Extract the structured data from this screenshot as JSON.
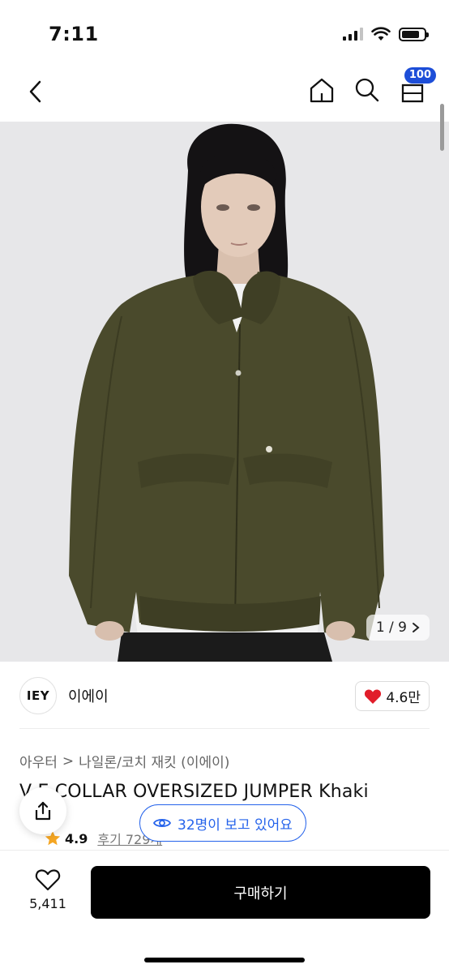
{
  "status_bar": {
    "time": "7:11"
  },
  "nav": {
    "cart_count": "100"
  },
  "product_image": {
    "counter": "1 / 9"
  },
  "brand": {
    "logo_text": "IEY",
    "name": "이에이",
    "likes": "4.6만"
  },
  "breadcrumb": {
    "category": "아우터",
    "separator": ">",
    "subcategory": "나일론/코치 재킷 (이에이)"
  },
  "product": {
    "title": "V   E COLLAR OVERSIZED JUMPER Khaki"
  },
  "rating": {
    "score": "4.9",
    "reviews": "후기 729개"
  },
  "viewers": {
    "text": "32명이 보고 있어요"
  },
  "bottom_bar": {
    "wish_count": "5,411",
    "buy_label": "구매하기"
  },
  "colors": {
    "accent": "#2563eb",
    "badge": "#1d4ed8",
    "like_red": "#e11d2a",
    "star": "#f5a623",
    "jacket": "#4a4a2c"
  }
}
